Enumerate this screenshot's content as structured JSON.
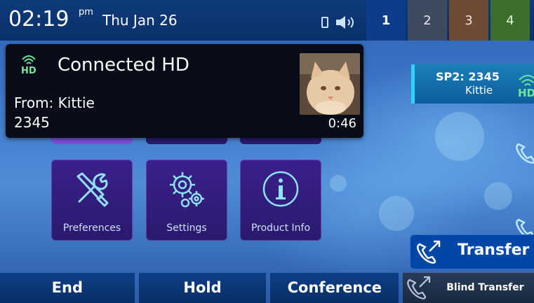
{
  "status_bar": {
    "time": "02:19",
    "ampm": "pm",
    "date": "Thu Jan 26",
    "line_tabs": [
      "1",
      "2",
      "3",
      "4"
    ]
  },
  "apps": [
    {
      "label": "Preferences",
      "icon": "wrench-screwdriver-icon"
    },
    {
      "label": "Settings",
      "icon": "gears-icon"
    },
    {
      "label": "Product Info",
      "icon": "info-icon"
    }
  ],
  "call": {
    "status": "Connected HD",
    "from": "From: Kittie",
    "number": "2345",
    "duration": "0:46"
  },
  "line_key": {
    "title": "SP2: 2345",
    "subtitle": "Kittie"
  },
  "transfer": {
    "label": "Transfer"
  },
  "softkeys": {
    "end": "End",
    "hold": "Hold",
    "conference": "Conference",
    "blind_transfer": "Blind Transfer"
  },
  "colors": {
    "accent": "#31d1ff",
    "hd_green": "#6ee6a0",
    "app_tile": "#2a1a6e",
    "popup_bg": "#070c18"
  }
}
